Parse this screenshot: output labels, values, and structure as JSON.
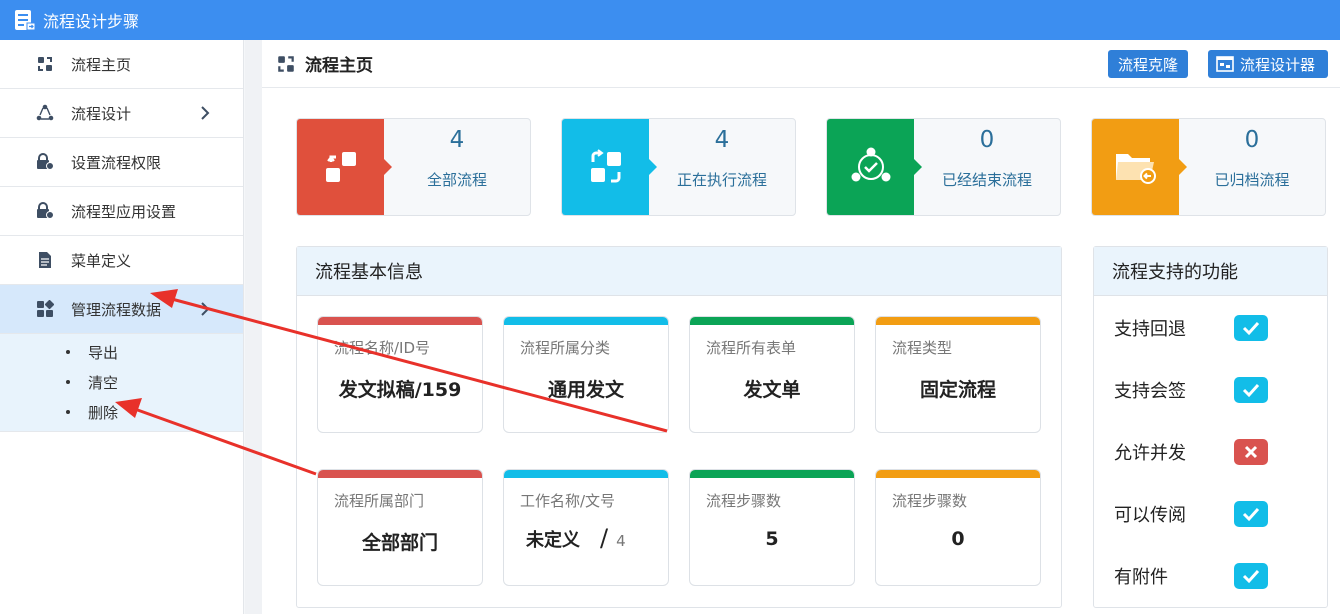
{
  "window": {
    "title": "流程设计步骤"
  },
  "sidebar": {
    "items": [
      {
        "label": "流程主页",
        "icon": "workflow-icon"
      },
      {
        "label": "流程设计",
        "icon": "share-icon",
        "has_chevron": true
      },
      {
        "label": "设置流程权限",
        "icon": "lock-gear-icon"
      },
      {
        "label": "流程型应用设置",
        "icon": "lock-gear-icon"
      },
      {
        "label": "菜单定义",
        "icon": "document-icon"
      },
      {
        "label": "管理流程数据",
        "icon": "grid-icon",
        "has_chevron": true,
        "active": true
      }
    ],
    "submenu": [
      {
        "label": "导出"
      },
      {
        "label": "清空"
      },
      {
        "label": "删除"
      }
    ]
  },
  "header": {
    "title": "流程主页",
    "clone_label": "流程克隆",
    "designer_label": "流程设计器"
  },
  "stats": [
    {
      "value": "4",
      "label": "全部流程",
      "color": "#e0503c"
    },
    {
      "value": "4",
      "label": "正在执行流程",
      "color": "#12bde8"
    },
    {
      "value": "0",
      "label": "已经结束流程",
      "color": "#0ba456"
    },
    {
      "value": "0",
      "label": "已归档流程",
      "color": "#f29d13"
    }
  ],
  "info": {
    "title": "流程基本信息",
    "cards": [
      {
        "label": "流程名称/ID号",
        "value": "发文拟稿/159",
        "color": "#d9534f"
      },
      {
        "label": "流程所属分类",
        "value": "通用发文",
        "color": "#12bde8"
      },
      {
        "label": "流程所有表单",
        "value": "发文单",
        "color": "#0ba456"
      },
      {
        "label": "流程类型",
        "value": "固定流程",
        "color": "#f29d13"
      },
      {
        "label": "流程所属部门",
        "value": "全部部门",
        "color": "#d9534f"
      },
      {
        "label": "工作名称/文号",
        "value": "未定义",
        "value_extra": "4",
        "color": "#12bde8"
      },
      {
        "label": "流程步骤数",
        "value": "5",
        "color": "#0ba456"
      },
      {
        "label": "流程步骤数",
        "value": "0",
        "color": "#f29d13"
      }
    ]
  },
  "functions": {
    "title": "流程支持的功能",
    "items": [
      {
        "label": "支持回退",
        "enabled": true
      },
      {
        "label": "支持会签",
        "enabled": true
      },
      {
        "label": "允许并发",
        "enabled": false
      },
      {
        "label": "可以传阅",
        "enabled": true
      },
      {
        "label": "有附件",
        "enabled": true
      }
    ]
  },
  "colors": {
    "titlebar": "#3c8ef0",
    "button": "#2f7fd8",
    "check_on": "#12bde8",
    "check_off": "#d9534f",
    "annotation": "#e8312a"
  }
}
